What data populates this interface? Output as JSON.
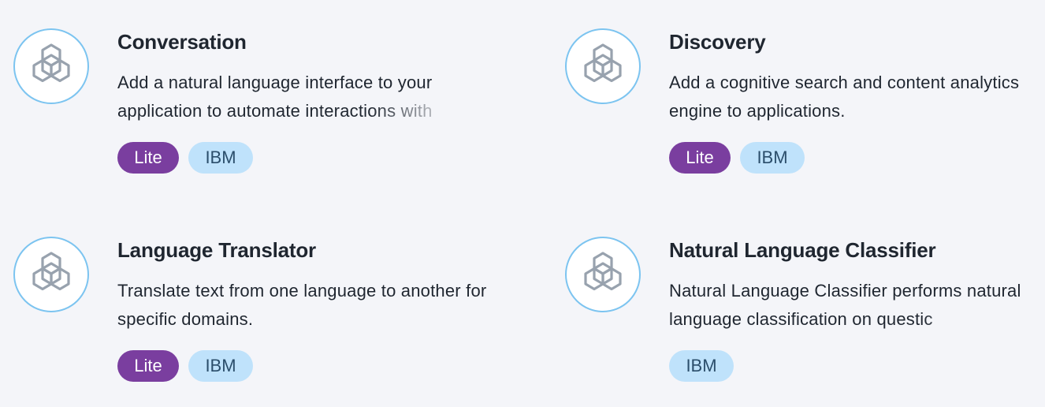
{
  "colors": {
    "background": "#f4f5f9",
    "logo_ring": "#7cc4f0",
    "lite_tag": "#7a3e9f",
    "ibm_tag": "#bfe2fb",
    "icon_stroke": "#98a2ae"
  },
  "cards": [
    {
      "icon": "watson-hexagon-icon",
      "title": "Conversation",
      "description": "Add a natural language interface to your application to automate interactions with",
      "tags": {
        "lite": "Lite",
        "provider": "IBM"
      }
    },
    {
      "icon": "watson-hexagon-icon",
      "title": "Discovery",
      "description": "Add a cognitive search and content analytics engine to applications.",
      "tags": {
        "lite": "Lite",
        "provider": "IBM"
      }
    },
    {
      "icon": "watson-hexagon-icon",
      "title": "Language Translator",
      "description": "Translate text from one language to another for specific domains.",
      "tags": {
        "lite": "Lite",
        "provider": "IBM"
      }
    },
    {
      "icon": "watson-hexagon-icon",
      "title": "Natural Language Classifier",
      "description": "Natural Language Classifier performs natural language classification on questic",
      "tags": {
        "provider": "IBM"
      }
    }
  ]
}
